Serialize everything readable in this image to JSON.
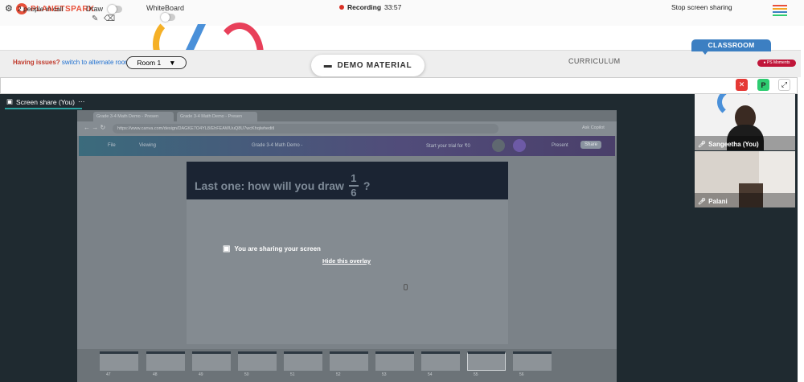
{
  "brand": {
    "name": "PLANETSPARK"
  },
  "toolbar": {
    "draw_label": "Draw",
    "whiteboard_label": "WhiteBoard",
    "draw_on": false,
    "whiteboard_on": false
  },
  "header": {
    "issues_text": "Having issues?",
    "issues_link": "switch to alternate room",
    "room_selected": "Room 1",
    "demo_material": "DEMO MATERIAL",
    "curriculum": "CURRICULUM",
    "classroom_tab": "CLASSROOM",
    "ps_moments": "PS Moments"
  },
  "callbar": {
    "people": "2 people in call",
    "recording_label": "Recording",
    "recording_time": "33:57",
    "stop_share": "Stop screen sharing",
    "p_badge": "P"
  },
  "share": {
    "label": "Screen share (You)",
    "browser_tabs": [
      "Grade 3-4 Math Demo - Presen",
      "Grade 3-4 Math Demo - Presen"
    ],
    "url": "https://www.canva.com/design/DAGKE7O4YL8/EhFEAWUuQ8U7wcKhqlwheditI",
    "canva_file": "File",
    "canva_viewing": "Viewing",
    "canva_title": "Grade 3-4 Math Demo -",
    "canva_trial": "Start your trial for ₹0",
    "canva_present": "Present",
    "canva_share": "Share",
    "ask_copilot": "Ask Copilot",
    "slide_question": "Last one: how will you draw",
    "fraction_num": "1",
    "fraction_den": "6",
    "question_mark": "?",
    "overlay_text": "You are sharing your screen",
    "overlay_link": "Hide this overlay",
    "thumb_numbers": [
      "47",
      "48",
      "49",
      "50",
      "51",
      "52",
      "53",
      "54",
      "55",
      "56"
    ]
  },
  "participants": [
    {
      "name": "Sangeetha (You)"
    },
    {
      "name": "Palani"
    }
  ],
  "colors": {
    "recording": "#d93025",
    "classroom": "#3c7fc2",
    "ps_moments": "#c0163a",
    "stop_button": "#e53935",
    "p_badge": "#2ecc71",
    "share_accent": "#2aa2a0"
  }
}
